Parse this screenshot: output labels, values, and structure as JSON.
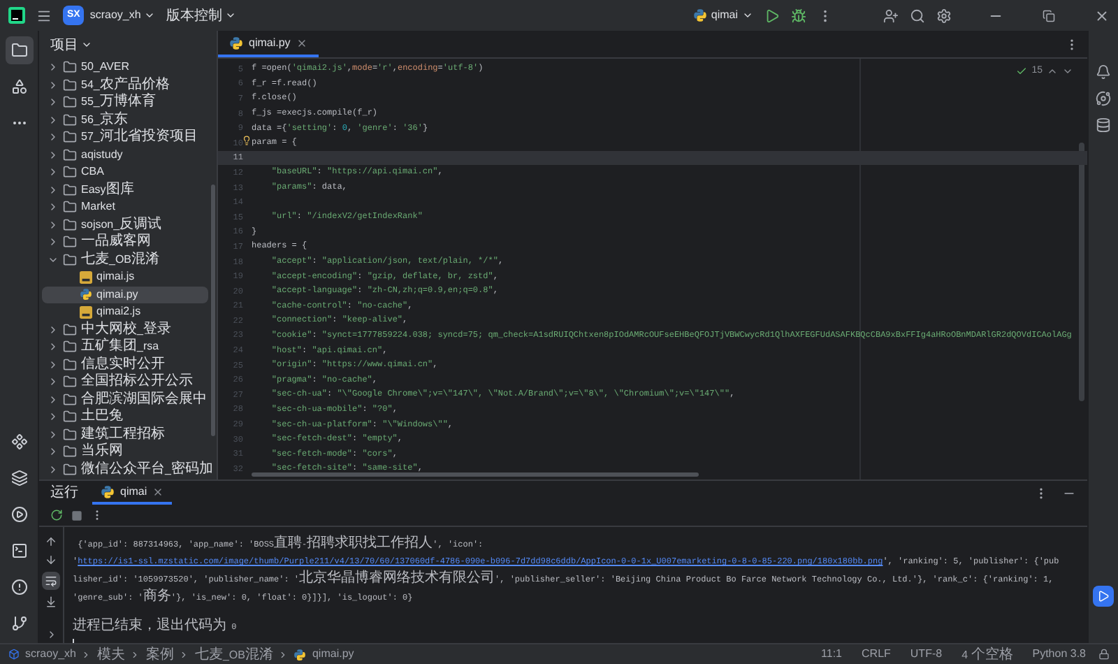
{
  "title_bar": {
    "project_badge": "SX",
    "project": "scraoy_xh",
    "vcs": "版本控制",
    "run_config": "qimai"
  },
  "project_panel": {
    "title": "项目",
    "tree": [
      {
        "name": "50_AVER",
        "kind": "folder",
        "expanded": false,
        "selected": false
      },
      {
        "name": "54_农产品价格",
        "kind": "folder",
        "expanded": false,
        "selected": false
      },
      {
        "name": "55_万博体育",
        "kind": "folder",
        "expanded": false,
        "selected": false
      },
      {
        "name": "56_京东",
        "kind": "folder",
        "expanded": false,
        "selected": false
      },
      {
        "name": "57_河北省投资项目",
        "kind": "folder",
        "expanded": false,
        "selected": false
      },
      {
        "name": "aqistudy",
        "kind": "folder",
        "expanded": false,
        "selected": false
      },
      {
        "name": "CBA",
        "kind": "folder",
        "expanded": false,
        "selected": false
      },
      {
        "name": "Easy图库",
        "kind": "folder",
        "expanded": false,
        "selected": false
      },
      {
        "name": "Market",
        "kind": "folder",
        "expanded": false,
        "selected": false
      },
      {
        "name": "sojson_反调试",
        "kind": "folder",
        "expanded": false,
        "selected": false
      },
      {
        "name": "一品威客网",
        "kind": "folder",
        "expanded": false,
        "selected": false
      },
      {
        "name": "七麦_OB混淆",
        "kind": "folder",
        "expanded": true,
        "selected": false,
        "children": [
          {
            "name": "qimai.js",
            "kind": "js",
            "selected": false
          },
          {
            "name": "qimai.py",
            "kind": "py",
            "selected": true
          },
          {
            "name": "qimai2.js",
            "kind": "js",
            "selected": false
          }
        ]
      },
      {
        "name": "中大网校_登录",
        "kind": "folder",
        "expanded": false,
        "selected": false
      },
      {
        "name": "五矿集团_rsa",
        "kind": "folder",
        "expanded": false,
        "selected": false
      },
      {
        "name": "信息实时公开",
        "kind": "folder",
        "expanded": false,
        "selected": false
      },
      {
        "name": "全国招标公开公示",
        "kind": "folder",
        "expanded": false,
        "selected": false
      },
      {
        "name": "合肥滨湖国际会展中",
        "kind": "folder",
        "expanded": false,
        "selected": false
      },
      {
        "name": "土巴兔",
        "kind": "folder",
        "expanded": false,
        "selected": false
      },
      {
        "name": "建筑工程招标",
        "kind": "folder",
        "expanded": false,
        "selected": false
      },
      {
        "name": "当乐网",
        "kind": "folder",
        "expanded": false,
        "selected": false
      },
      {
        "name": "微信公众平台_密码加",
        "kind": "folder",
        "expanded": false,
        "selected": false
      }
    ]
  },
  "editor": {
    "tabs": [
      {
        "label": "qimai.py",
        "selected": true
      }
    ],
    "inspections": "15",
    "lines": [
      {
        "n": "5",
        "current": false,
        "indented": false,
        "tokens": [
          {
            "kind": "plain",
            "text": "f =open("
          },
          {
            "kind": "string",
            "text": "'qimai2.js'"
          },
          {
            "kind": "plain",
            "text": ","
          },
          {
            "kind": "keyword",
            "text": "mode"
          },
          {
            "kind": "plain",
            "text": "="
          },
          {
            "kind": "string",
            "text": "'r'"
          },
          {
            "kind": "plain",
            "text": ","
          },
          {
            "kind": "keyword",
            "text": "encoding"
          },
          {
            "kind": "plain",
            "text": "="
          },
          {
            "kind": "string",
            "text": "'utf-8'"
          },
          {
            "kind": "plain",
            "text": ")"
          }
        ]
      },
      {
        "n": "6",
        "current": false,
        "indented": false,
        "tokens": [
          {
            "kind": "plain",
            "text": "f_r =f.read()"
          }
        ]
      },
      {
        "n": "7",
        "current": false,
        "indented": false,
        "tokens": [
          {
            "kind": "plain",
            "text": "f.close()"
          }
        ]
      },
      {
        "n": "8",
        "current": false,
        "indented": false,
        "tokens": [
          {
            "kind": "plain",
            "text": "f_js =execjs.compile(f_r)"
          }
        ]
      },
      {
        "n": "9",
        "current": false,
        "indented": false,
        "tokens": [
          {
            "kind": "plain",
            "text": "data ={"
          },
          {
            "kind": "string",
            "text": "'setting'"
          },
          {
            "kind": "plain",
            "text": ": "
          },
          {
            "kind": "number",
            "text": "0"
          },
          {
            "kind": "plain",
            "text": ", "
          },
          {
            "kind": "string",
            "text": "'genre'"
          },
          {
            "kind": "plain",
            "text": ": "
          },
          {
            "kind": "string",
            "text": "'36'"
          },
          {
            "kind": "plain",
            "text": "}"
          }
        ]
      },
      {
        "n": "10",
        "current": false,
        "indented": false,
        "hint": true,
        "tokens": [
          {
            "kind": "plain",
            "text": "param = {"
          }
        ]
      },
      {
        "n": "11",
        "current": true
      },
      {
        "n": "12",
        "current": false,
        "indented": true,
        "tokens": [
          {
            "kind": "string",
            "text": "\"baseURL\""
          },
          {
            "kind": "plain",
            "text": ": "
          },
          {
            "kind": "string",
            "text": "\"https://api.qimai.cn\""
          },
          {
            "kind": "plain",
            "text": ","
          }
        ]
      },
      {
        "n": "13",
        "current": false,
        "indented": true,
        "tokens": [
          {
            "kind": "string",
            "text": "\"params\""
          },
          {
            "kind": "plain",
            "text": ": data,"
          }
        ]
      },
      {
        "n": "14",
        "current": false
      },
      {
        "n": "15",
        "current": false,
        "indented": true,
        "tokens": [
          {
            "kind": "string",
            "text": "\"url\""
          },
          {
            "kind": "plain",
            "text": ": "
          },
          {
            "kind": "string",
            "text": "\"/indexV2/getIndexRank\""
          }
        ]
      },
      {
        "n": "16",
        "current": false,
        "indented": false,
        "tokens": [
          {
            "kind": "plain",
            "text": "}"
          }
        ]
      },
      {
        "n": "17",
        "current": false,
        "indented": false,
        "tokens": [
          {
            "kind": "plain",
            "text": "headers = {"
          }
        ]
      },
      {
        "n": "18",
        "current": false,
        "indented": true,
        "tokens": [
          {
            "kind": "string",
            "text": "\"accept\""
          },
          {
            "kind": "plain",
            "text": ": "
          },
          {
            "kind": "string",
            "text": "\"application/json, text/plain, */*\""
          },
          {
            "kind": "plain",
            "text": ","
          }
        ]
      },
      {
        "n": "19",
        "current": false,
        "indented": true,
        "tokens": [
          {
            "kind": "string",
            "text": "\"accept-encoding\""
          },
          {
            "kind": "plain",
            "text": ": "
          },
          {
            "kind": "string",
            "text": "\"gzip, deflate, br, zstd\""
          },
          {
            "kind": "plain",
            "text": ","
          }
        ]
      },
      {
        "n": "20",
        "current": false,
        "indented": true,
        "tokens": [
          {
            "kind": "string",
            "text": "\"accept-language\""
          },
          {
            "kind": "plain",
            "text": ": "
          },
          {
            "kind": "string",
            "text": "\"zh-CN,zh;q=0.9,en;q=0.8\""
          },
          {
            "kind": "plain",
            "text": ","
          }
        ]
      },
      {
        "n": "21",
        "current": false,
        "indented": true,
        "tokens": [
          {
            "kind": "string",
            "text": "\"cache-control\""
          },
          {
            "kind": "plain",
            "text": ": "
          },
          {
            "kind": "string",
            "text": "\"no-cache\""
          },
          {
            "kind": "plain",
            "text": ","
          }
        ]
      },
      {
        "n": "22",
        "current": false,
        "indented": true,
        "tokens": [
          {
            "kind": "string",
            "text": "\"connection\""
          },
          {
            "kind": "plain",
            "text": ": "
          },
          {
            "kind": "string",
            "text": "\"keep-alive\""
          },
          {
            "kind": "plain",
            "text": ","
          }
        ]
      },
      {
        "n": "23",
        "current": false,
        "indented": true,
        "tokens": [
          {
            "kind": "string",
            "text": "\"cookie\""
          },
          {
            "kind": "plain",
            "text": ": "
          },
          {
            "kind": "string",
            "text": "\"synct=1777859224.038; syncd=75; qm_check=A1sdRUIQChtxen8pIOdAMRcOUFseEHBeQFOJTjVBWCwycRd1QlhAXFEGFUdASAFKBQcCBA9xBxFFIg4aHRoOBnMDARlGR2dQOVdICAolAGg"
          }
        ]
      },
      {
        "n": "24",
        "current": false,
        "indented": true,
        "tokens": [
          {
            "kind": "string",
            "text": "\"host\""
          },
          {
            "kind": "plain",
            "text": ": "
          },
          {
            "kind": "string",
            "text": "\"api.qimai.cn\""
          },
          {
            "kind": "plain",
            "text": ","
          }
        ]
      },
      {
        "n": "25",
        "current": false,
        "indented": true,
        "tokens": [
          {
            "kind": "string",
            "text": "\"origin\""
          },
          {
            "kind": "plain",
            "text": ": "
          },
          {
            "kind": "string",
            "text": "\"https://www.qimai.cn\""
          },
          {
            "kind": "plain",
            "text": ","
          }
        ]
      },
      {
        "n": "26",
        "current": false,
        "indented": true,
        "tokens": [
          {
            "kind": "string",
            "text": "\"pragma\""
          },
          {
            "kind": "plain",
            "text": ": "
          },
          {
            "kind": "string",
            "text": "\"no-cache\""
          },
          {
            "kind": "plain",
            "text": ","
          }
        ]
      },
      {
        "n": "27",
        "current": false,
        "indented": true,
        "tokens": [
          {
            "kind": "string",
            "text": "\"sec-ch-ua\""
          },
          {
            "kind": "plain",
            "text": ": "
          },
          {
            "kind": "string",
            "text": "\"\\\"Google Chrome\\\";v=\\\"147\\\", \\\"Not.A/Brand\\\";v=\\\"8\\\", \\\"Chromium\\\";v=\\\"147\\\"\""
          },
          {
            "kind": "plain",
            "text": ","
          }
        ]
      },
      {
        "n": "28",
        "current": false,
        "indented": true,
        "tokens": [
          {
            "kind": "string",
            "text": "\"sec-ch-ua-mobile\""
          },
          {
            "kind": "plain",
            "text": ": "
          },
          {
            "kind": "string",
            "text": "\"?0\""
          },
          {
            "kind": "plain",
            "text": ","
          }
        ]
      },
      {
        "n": "29",
        "current": false,
        "indented": true,
        "tokens": [
          {
            "kind": "string",
            "text": "\"sec-ch-ua-platform\""
          },
          {
            "kind": "plain",
            "text": ": "
          },
          {
            "kind": "string",
            "text": "\"\\\"Windows\\\"\""
          },
          {
            "kind": "plain",
            "text": ","
          }
        ]
      },
      {
        "n": "30",
        "current": false,
        "indented": true,
        "tokens": [
          {
            "kind": "string",
            "text": "\"sec-fetch-dest\""
          },
          {
            "kind": "plain",
            "text": ": "
          },
          {
            "kind": "string",
            "text": "\"empty\""
          },
          {
            "kind": "plain",
            "text": ","
          }
        ]
      },
      {
        "n": "31",
        "current": false,
        "indented": true,
        "tokens": [
          {
            "kind": "string",
            "text": "\"sec-fetch-mode\""
          },
          {
            "kind": "plain",
            "text": ": "
          },
          {
            "kind": "string",
            "text": "\"cors\""
          },
          {
            "kind": "plain",
            "text": ","
          }
        ]
      },
      {
        "n": "32",
        "current": false,
        "indented": true,
        "tokens": [
          {
            "kind": "string",
            "text": "\"sec-fetch-site\""
          },
          {
            "kind": "plain",
            "text": ": "
          },
          {
            "kind": "string",
            "text": "\"same-site\""
          },
          {
            "kind": "plain",
            "text": ","
          }
        ]
      }
    ]
  },
  "run_panel": {
    "title": "运行",
    "tabs": [
      {
        "label": "qimai",
        "selected": true
      }
    ],
    "soft_wrap_on": true,
    "output": [
      {
        "kind": "text",
        "text": " {'app_id': 887314963, 'app_name': 'BOSS直聘-招聘求职找工作招人', 'icon': '"
      },
      {
        "kind": "link",
        "text": "https://is1-ssl.mzstatic.com/image/thumb/Purple211/v4/13/70/60/137060df-4786-090e-b096-7d7dd98c6ddb/AppIcon-0-0-1x_U007emarketing-0-8-0-85-220.png/180x180bb.png"
      },
      {
        "kind": "text",
        "text": "', 'ranking': 5, 'publisher': {'publisher_id': '1059973520', 'publisher_name': '北京华晶博睿网络技术有限公司', 'publisher_seller': 'Beijing China Product Bo Farce Network Technology Co., Ltd.'}, 'rank_c': {'ranking': 1, 'genre_sub': '商务'}, 'is_new': 0, 'float': 0}]}], 'is_logout': 0}"
      }
    ],
    "exit_message": "进程已结束，退出代码为 0"
  },
  "status_bar": {
    "breadcrumb": [
      {
        "label": "scraoy_xh",
        "kind": "project"
      },
      {
        "label": "模夫",
        "kind": "folder"
      },
      {
        "label": "案例",
        "kind": "folder"
      },
      {
        "label": "七麦_OB混淆",
        "kind": "folder"
      },
      {
        "label": "qimai.py",
        "kind": "py"
      }
    ],
    "items": [
      "11:1",
      "CRLF",
      "UTF-8",
      "4 个空格",
      "Python 3.8"
    ]
  }
}
